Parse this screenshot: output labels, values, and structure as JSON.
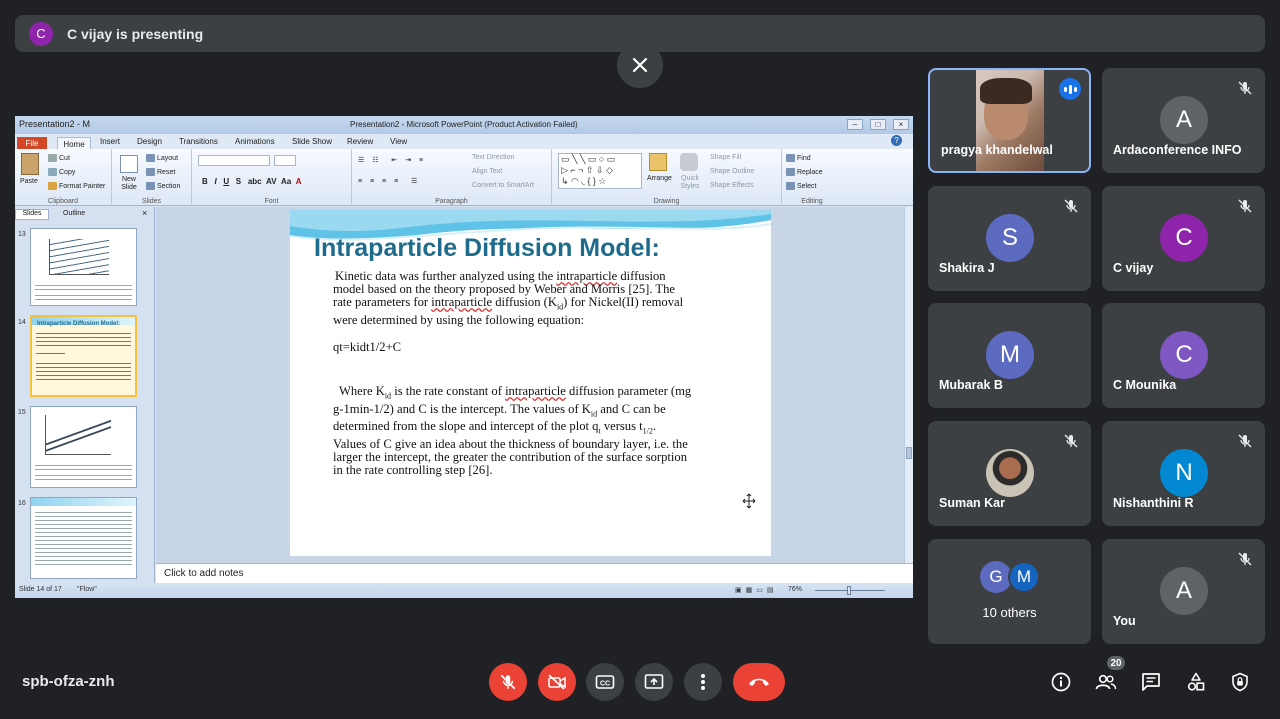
{
  "presenting": {
    "initial": "C",
    "text": "C vijay is presenting",
    "avatar_color": "#8e24aa"
  },
  "ppt": {
    "titlebar_left": "Presentation2 - M",
    "titlebar_center": "Presentation2 - Microsoft PowerPoint (Product Activation Failed)",
    "tabs": [
      "File",
      "Home",
      "Insert",
      "Design",
      "Transitions",
      "Animations",
      "Slide Show",
      "Review",
      "View"
    ],
    "ribbon": {
      "clipboard": {
        "paste": "Paste",
        "cut": "Cut",
        "copy": "Copy",
        "format_painter": "Format Painter",
        "label": "Clipboard"
      },
      "slides": {
        "new_slide": "New Slide",
        "layout": "Layout",
        "reset": "Reset",
        "section": "Section",
        "label": "Slides"
      },
      "font": {
        "label": "Font"
      },
      "paragraph": {
        "text_direction": "Text Direction",
        "align_text": "Align Text",
        "smartart": "Convert to SmartArt",
        "label": "Paragraph"
      },
      "drawing": {
        "arrange": "Arrange",
        "quick_styles": "Quick Styles",
        "shape_fill": "Shape Fill",
        "shape_outline": "Shape Outline",
        "shape_effects": "Shape Effects",
        "label": "Drawing"
      },
      "editing": {
        "find": "Find",
        "replace": "Replace",
        "select": "Select",
        "label": "Editing"
      }
    },
    "panel_tabs": {
      "slides": "Slides",
      "outline": "Outline"
    },
    "thumb_numbers": [
      "13",
      "14",
      "15",
      "16"
    ],
    "slide": {
      "title": "Intraparticle Diffusion Model:",
      "p1_line1_pre": "Kinetic data was further analyzed using the ",
      "p1_line1_link": "intraparticle",
      "p1_line1_post": " diffusion",
      "p1_line2": "model based on the theory proposed by Weber and Morris [25]. The",
      "p1_line3_pre": "rate parameters for ",
      "p1_line3_link": "intraparticle",
      "p1_line3_post": " diffusion (K",
      "p1_line3_sub": "id",
      "p1_line3_end": ") for Nickel(II) removal",
      "p1_line4": "were determined by using the following equation:",
      "equation": "qt=kidt1/2+C",
      "p2_line1_pre": "Where K",
      "p2_line1_sub": "id",
      "p2_line1_mid": " is the rate constant of ",
      "p2_line1_link": "intraparticle",
      "p2_line1_post": " diffusion parameter (mg",
      "p2_line2_pre": "g-1min-1/2) and C is the intercept. The values of K",
      "p2_line2_sub": "id",
      "p2_line2_post": " and C can be",
      "p2_line3_pre": "determined from the slope and intercept of the plot q",
      "p2_line3_sub1": "t",
      "p2_line3_mid": " versus t",
      "p2_line3_sub2": "1/2",
      "p2_line3_end": ".",
      "p2_line4": "Values of C give an idea about the thickness of boundary layer, i.e. the",
      "p2_line5": "larger the intercept, the greater the contribution of the surface sorption",
      "p2_line6": "in the rate controlling step [26]."
    },
    "notes_placeholder": "Click to add notes",
    "status": {
      "slide_count": "Slide 14 of 17",
      "theme": "\"Flow\"",
      "zoom": "76%"
    }
  },
  "participants": [
    {
      "name": "pragya khandelwal",
      "type": "video",
      "speaking": true
    },
    {
      "name": "Ardaconference INFO",
      "initial": "A",
      "color": "#5f6368",
      "muted": true
    },
    {
      "name": "Shakira J",
      "initial": "S",
      "color": "#5c6bc0",
      "muted": true
    },
    {
      "name": "C vijay",
      "initial": "C",
      "color": "#8e24aa",
      "muted": true
    },
    {
      "name": "Mubarak B",
      "initial": "M",
      "color": "#5c6bc0",
      "muted": false
    },
    {
      "name": "C Mounika",
      "initial": "C",
      "color": "#7e57c2",
      "muted": false
    },
    {
      "name": "Suman Kar",
      "type": "photo",
      "muted": true
    },
    {
      "name": "Nishanthini R",
      "initial": "N",
      "color": "#0288d1",
      "muted": true
    },
    {
      "name": "10 others",
      "initials": [
        "G",
        "M"
      ],
      "colors": [
        "#5c6bc0",
        "#1565c0"
      ]
    },
    {
      "name": "You",
      "initial": "A",
      "color": "#5f6368",
      "muted": true
    }
  ],
  "meeting": {
    "code": "spb-ofza-znh",
    "participant_count": "20"
  }
}
